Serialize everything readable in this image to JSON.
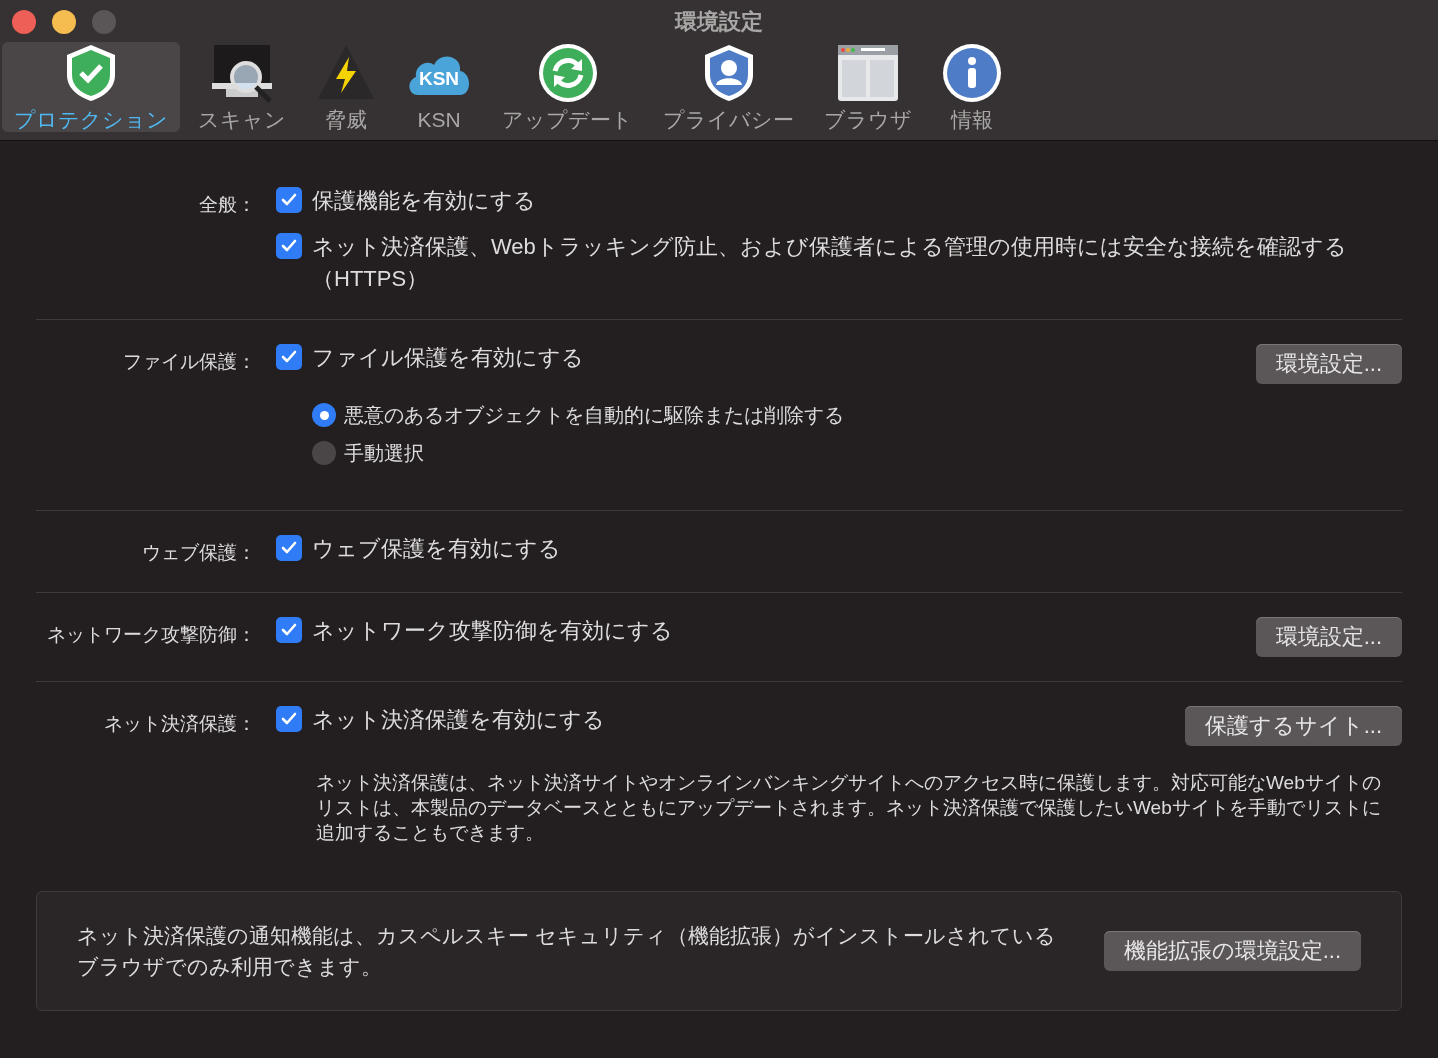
{
  "window": {
    "title": "環境設定"
  },
  "toolbar": [
    {
      "kind": "shield",
      "label": "プロテクション",
      "selected": true
    },
    {
      "kind": "scan",
      "label": "スキャン",
      "selected": false
    },
    {
      "kind": "threat",
      "label": "脅威",
      "selected": false
    },
    {
      "kind": "cloud",
      "label": "KSN",
      "icon_text": "KSN",
      "selected": false
    },
    {
      "kind": "update",
      "label": "アップデート",
      "selected": false
    },
    {
      "kind": "privacy",
      "label": "プライバシー",
      "selected": false
    },
    {
      "kind": "browser",
      "label": "ブラウザ",
      "selected": false
    },
    {
      "kind": "info",
      "label": "情報",
      "selected": false
    }
  ],
  "sections": [
    {
      "label": "全般：",
      "checkboxes": [
        {
          "label": "保護機能を有効にする",
          "checked": true
        },
        {
          "label": "ネット決済保護、Webトラッキング防止、および保護者による管理の使用時には安全な接続を確認する（HTTPS）",
          "checked": true
        }
      ]
    },
    {
      "label": "ファイル保護：",
      "checkboxes": [
        {
          "label": "ファイル保護を有効にする",
          "checked": true
        }
      ],
      "button": "環境設定...",
      "radios": [
        {
          "label": "悪意のあるオブジェクトを自動的に駆除または削除する",
          "selected": true
        },
        {
          "label": "手動選択",
          "selected": false
        }
      ]
    },
    {
      "label": "ウェブ保護：",
      "checkboxes": [
        {
          "label": "ウェブ保護を有効にする",
          "checked": true
        }
      ]
    },
    {
      "label": "ネットワーク攻撃防御：",
      "checkboxes": [
        {
          "label": "ネットワーク攻撃防御を有効にする",
          "checked": true
        }
      ],
      "button": "環境設定..."
    },
    {
      "label": "ネット決済保護：",
      "checkboxes": [
        {
          "label": "ネット決済保護を有効にする",
          "checked": true
        }
      ],
      "button": "保護するサイト...",
      "description": "ネット決済保護は、ネット決済サイトやオンラインバンキングサイトへのアクセス時に保護します。対応可能なWebサイトのリストは、本製品のデータベースとともにアップデートされます。ネット決済保護で保護したいWebサイトを手動でリストに追加することもできます。"
    }
  ],
  "notice": {
    "text": "ネット決済保護の通知機能は、カスペルスキー セキュリティ（機能拡張）がインストールされているブラウザでのみ利用できます。",
    "button": "機能拡張の環境設定..."
  }
}
